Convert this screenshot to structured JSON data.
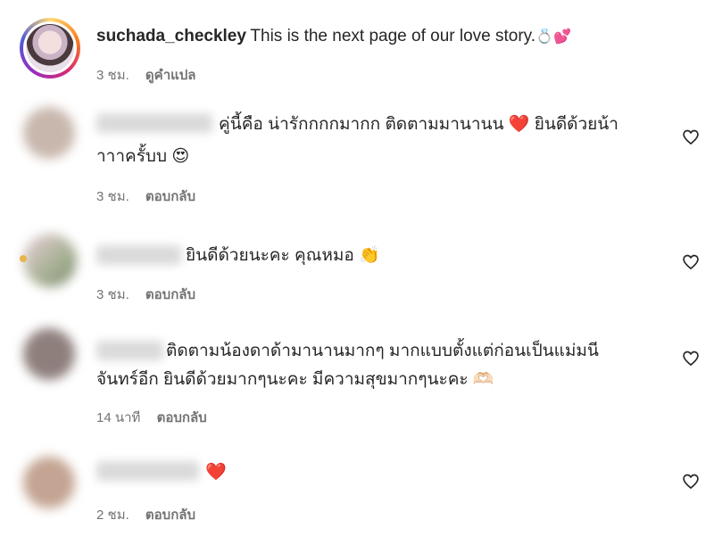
{
  "caption": {
    "username": "suchada_checkley",
    "text": "This is the next page of our love story.",
    "emojis": "💍💕",
    "time": "3 ชม.",
    "translate_label": "ดูคำแปล"
  },
  "comments": [
    {
      "line1": "คู่นี้คือ น่ารักกกกมากก ติดตามมานานน ❤️ ยินดีด้วยน้า",
      "line2": "าาาครั้บบ 😍",
      "time": "3 ชม.",
      "reply_label": "ตอบกลับ"
    },
    {
      "line1": "ยินดีด้วยนะคะ คุณหมอ 👏",
      "time": "3 ชม.",
      "reply_label": "ตอบกลับ"
    },
    {
      "line1": "ติดตามน้องดาด้ามานานมากๆ มากแบบตั้งแต่ก่อนเป็นแม่มนี",
      "line2": "จันทร์อีก ยินดีด้วยมากๆนะคะ มีความสุขมากๆนะคะ 🫶🏻",
      "time": "14 นาที",
      "reply_label": "ตอบกลับ"
    },
    {
      "line1": "❤️",
      "time": "2 ชม.",
      "reply_label": "ตอบกลับ"
    }
  ],
  "icons": {
    "like": "heart-outline-icon"
  }
}
